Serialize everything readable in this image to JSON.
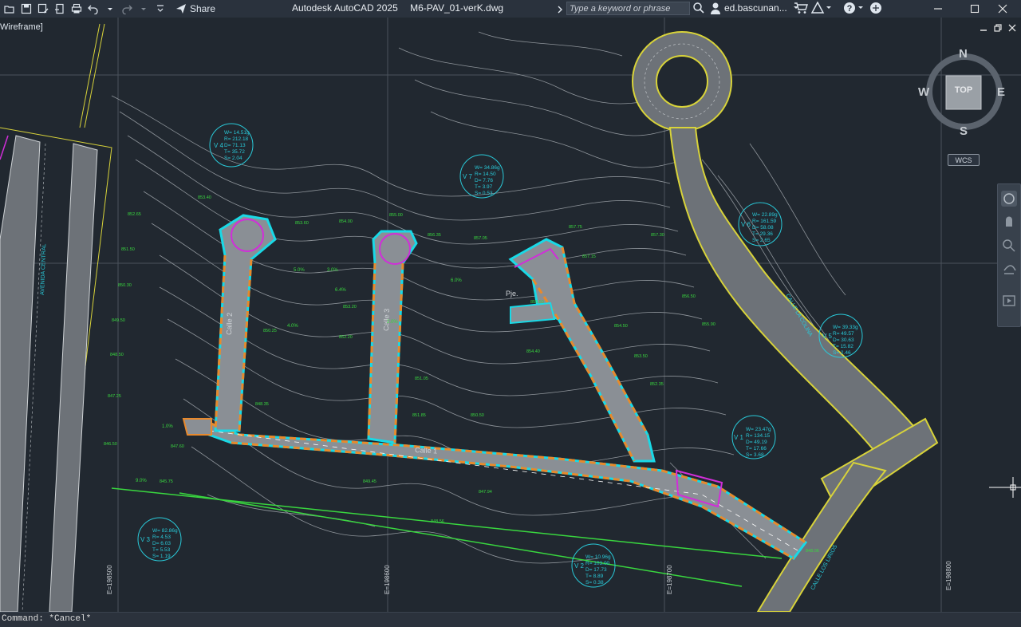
{
  "app": {
    "name": "Autodesk AutoCAD 2025",
    "file": "M6-PAV_01-verK.dwg",
    "share_label": "Share",
    "user": "ed.bascunan...",
    "search_placeholder": "Type a keyword or phrase"
  },
  "viewport": {
    "visual_style": "Wireframe]",
    "viewcube": {
      "top": "TOP",
      "n": "N",
      "s": "S",
      "e": "E",
      "w": "W"
    },
    "wcs": "WCS"
  },
  "streets": {
    "calle1": "Calle 1",
    "calle2": "Calle 2",
    "calle3": "Calle 3",
    "pje": "Pje.",
    "avenida": "AVENIDA CENTRAL",
    "calle_la_colina": "CALLE LA COLINA",
    "calle_los_lirios": "CALLE LOS LIRIOS"
  },
  "curves": [
    {
      "id": "V 4",
      "w": "W= 14.51g",
      "r": "R= 212.18",
      "d": "D= 71.13",
      "t": "T= 35.72",
      "s": "S= 2.04"
    },
    {
      "id": "V 7",
      "w": "W= 34.86g",
      "r": "R= 14.50",
      "d": "D= 7.76",
      "t": "T= 3.97",
      "s": "S= 0.53"
    },
    {
      "id": "V 6",
      "w": "W= 22.89g",
      "r": "R= 161.59",
      "d": "D= 58.08",
      "t": "T= 29.36",
      "s": "S= 2.65"
    },
    {
      "id": "V 5",
      "w": "W= 39.33g",
      "r": "R= 49.57",
      "d": "D= 30.63",
      "t": "T= 15.82",
      "s": "S= 2.46"
    },
    {
      "id": "V 1",
      "w": "W= 23.47g",
      "r": "R= 134.15",
      "d": "D= 49.19",
      "t": "T= 17.66",
      "s": "S= 3.68"
    },
    {
      "id": "V 3",
      "w": "W= 82.86g",
      "r": "R= 4.53",
      "d": "D= 6.03",
      "t": "T= 5.53",
      "s": "S= 1.19"
    },
    {
      "id": "V 2",
      "w": "W= 10.96g",
      "r": "R= 103.00",
      "d": "D= 17.73",
      "t": "T= 8.89",
      "s": "S= 0.38"
    }
  ],
  "coords": {
    "e1": "E=198500",
    "e2": "E=198600",
    "e3": "E=198700",
    "e4": "E=198800"
  },
  "elevations": [
    "853.40",
    "852.65",
    "851.50",
    "850.30",
    "849.50",
    "848.50",
    "847.25",
    "847.60",
    "846.50",
    "845.75",
    "853.60",
    "854.00",
    "855.00",
    "856.35",
    "857.05",
    "857.15",
    "857.30",
    "857.75",
    "855.90",
    "854.50",
    "853.20",
    "852.20",
    "851.05",
    "850.25",
    "848.35",
    "847.94",
    "848.56",
    "849.45",
    "850.50",
    "851.85",
    "852.35",
    "853.50",
    "854.40",
    "855.50",
    "856.50",
    "848.06"
  ],
  "gradients": [
    "5.0%",
    "3.0%",
    "2.0%",
    "6.0%",
    "6.4%",
    "4.0%",
    "1.0%",
    "9.0%"
  ],
  "command": "Command: *Cancel*",
  "colors": {
    "background": "#212830",
    "contour": "#9aa0a6",
    "road_fill": "#8a8f95",
    "curb_cyan": "#19d9e6",
    "curb_orange": "#e8892c",
    "magenta": "#d12ed9",
    "green_text": "#39d73f",
    "yellow": "#d8d33a",
    "label_cyan": "#29c9d8"
  }
}
